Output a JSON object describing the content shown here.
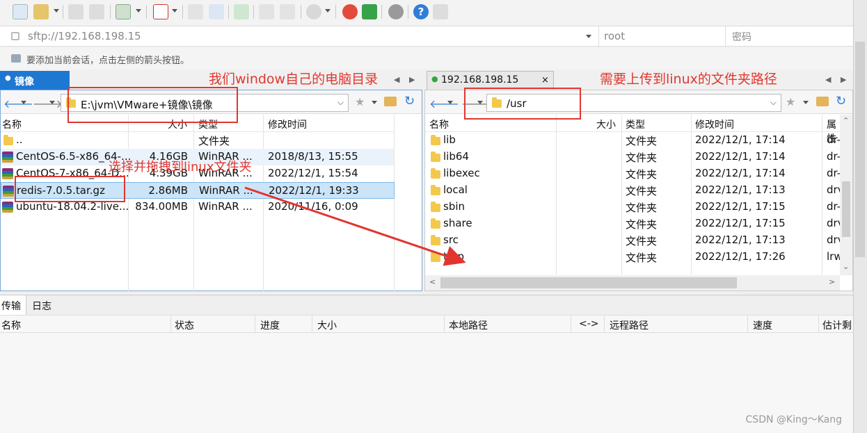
{
  "address": {
    "host": "sftp://192.168.198.15",
    "user": "root",
    "password_placeholder": "密码"
  },
  "hint": "要添加当前会话，点击左侧的箭头按钮。",
  "left_panel": {
    "tab_label": "镜像",
    "path": "E:\\jvm\\VMware+镜像\\镜像",
    "columns": [
      "名称",
      "大小",
      "类型",
      "修改时间"
    ],
    "rows": [
      {
        "name": "..",
        "size": "",
        "type": "文件夹",
        "modified": ""
      },
      {
        "name": "CentOS-6.5-x86_64-...",
        "size": "4.16GB",
        "type": "WinRAR ...",
        "modified": "2018/8/13, 15:55"
      },
      {
        "name": "CentOS-7-x86_64-D...",
        "size": "4.39GB",
        "type": "WinRAR ...",
        "modified": "2022/12/1, 15:54"
      },
      {
        "name": "redis-7.0.5.tar.gz",
        "size": "2.86MB",
        "type": "WinRAR ...",
        "modified": "2022/12/1, 19:33"
      },
      {
        "name": "ubuntu-18.04.2-live...",
        "size": "834.00MB",
        "type": "WinRAR ...",
        "modified": "2020/11/16, 0:09"
      }
    ]
  },
  "right_panel": {
    "tab_label": "192.168.198.15",
    "close": "×",
    "path": "/usr",
    "columns": [
      "名称",
      "大小",
      "类型",
      "修改时间",
      "属性"
    ],
    "rows": [
      {
        "name": "lib",
        "type": "文件夹",
        "modified": "2022/12/1, 17:14",
        "attr": "dr-"
      },
      {
        "name": "lib64",
        "type": "文件夹",
        "modified": "2022/12/1, 17:14",
        "attr": "dr-"
      },
      {
        "name": "libexec",
        "type": "文件夹",
        "modified": "2022/12/1, 17:14",
        "attr": "dr-"
      },
      {
        "name": "local",
        "type": "文件夹",
        "modified": "2022/12/1, 17:13",
        "attr": "drv"
      },
      {
        "name": "sbin",
        "type": "文件夹",
        "modified": "2022/12/1, 17:15",
        "attr": "dr-"
      },
      {
        "name": "share",
        "type": "文件夹",
        "modified": "2022/12/1, 17:15",
        "attr": "drv"
      },
      {
        "name": "src",
        "type": "文件夹",
        "modified": "2022/12/1, 17:13",
        "attr": "drv"
      },
      {
        "name": "tmp",
        "type": "文件夹",
        "modified": "2022/12/1, 17:26",
        "attr": "lrw"
      }
    ]
  },
  "annotations": {
    "left_dir": "我们window自己的电脑目录",
    "right_dir": "需要上传到linux的文件夹路径",
    "drag": "选择并拖拽到linux文件夹"
  },
  "transfer": {
    "tabs": [
      "传输",
      "日志"
    ],
    "columns": [
      "名称",
      "状态",
      "进度",
      "大小",
      "本地路径",
      "<->",
      "远程路径",
      "速度",
      "估计剩"
    ]
  },
  "watermark": "CSDN @King～Kang",
  "colors": {
    "accent": "#1e78d2",
    "annotation": "#e0362f",
    "selected_row": "#cce4f7"
  }
}
